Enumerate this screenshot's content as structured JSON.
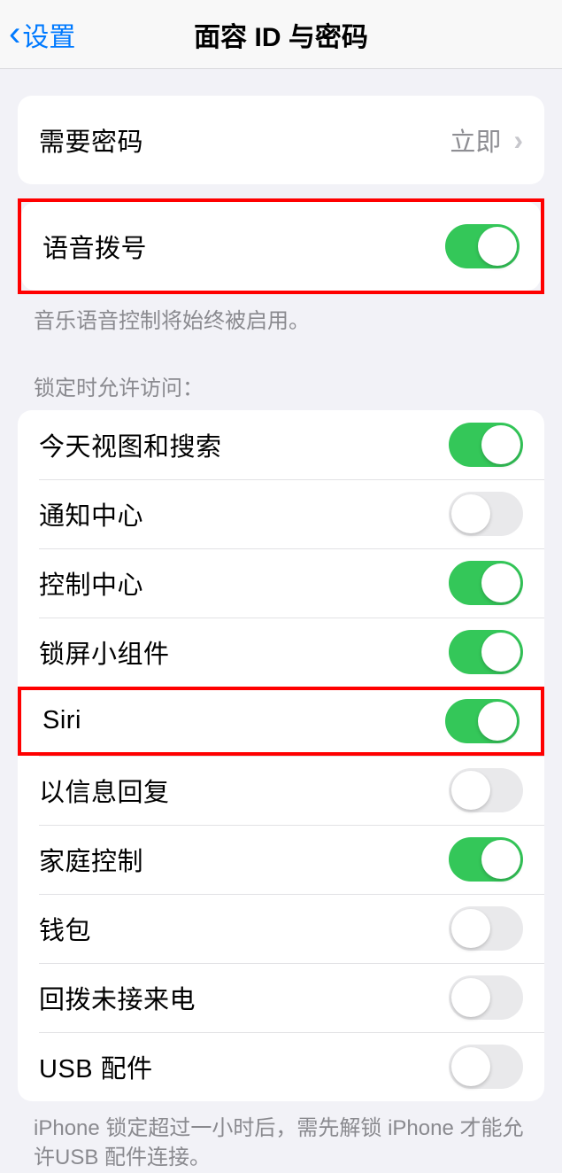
{
  "header": {
    "back_label": "设置",
    "title": "面容 ID 与密码"
  },
  "require_passcode": {
    "label": "需要密码",
    "value": "立即"
  },
  "voice_dial": {
    "label": "语音拨号",
    "footer": "音乐语音控制将始终被启用。"
  },
  "locked_access": {
    "header": "锁定时允许访问：",
    "items": [
      {
        "label": "今天视图和搜索",
        "on": true
      },
      {
        "label": "通知中心",
        "on": false
      },
      {
        "label": "控制中心",
        "on": true
      },
      {
        "label": "锁屏小组件",
        "on": true
      },
      {
        "label": "Siri",
        "on": true
      },
      {
        "label": "以信息回复",
        "on": false
      },
      {
        "label": "家庭控制",
        "on": true
      },
      {
        "label": "钱包",
        "on": false
      },
      {
        "label": "回拨未接来电",
        "on": false
      },
      {
        "label": "USB 配件",
        "on": false
      }
    ],
    "footer": "iPhone 锁定超过一小时后，需先解锁 iPhone 才能允许USB 配件连接。"
  }
}
